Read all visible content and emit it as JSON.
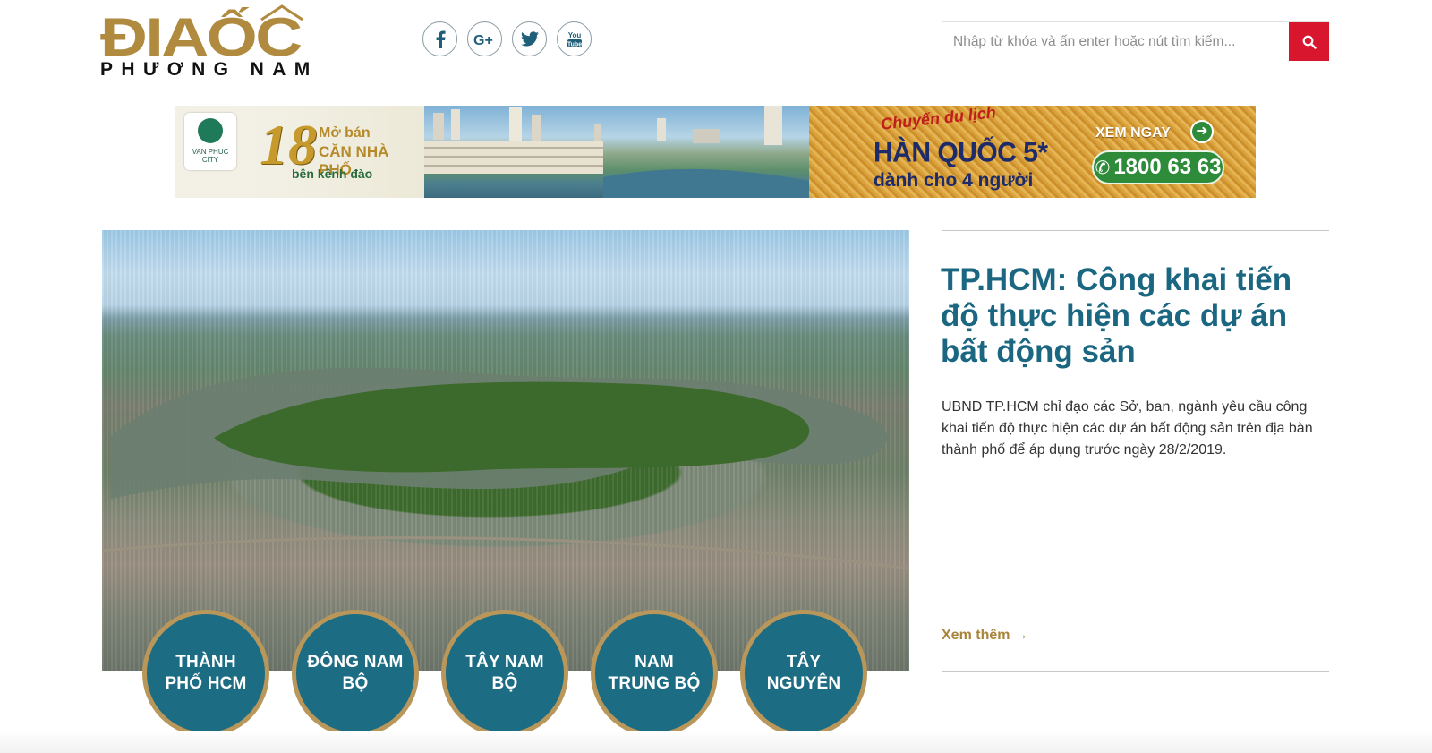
{
  "logo": {
    "top": "ĐIAỐC",
    "bottom": "PHƯƠNG NAM"
  },
  "social": [
    {
      "name": "facebook",
      "icon": "facebook-icon"
    },
    {
      "name": "google-plus",
      "icon": "google-plus-icon"
    },
    {
      "name": "twitter",
      "icon": "twitter-icon"
    },
    {
      "name": "youtube",
      "icon": "youtube-icon"
    }
  ],
  "search": {
    "placeholder": "Nhập từ khóa và ấn enter hoặc nút tìm kiếm...",
    "icon": "search-icon",
    "button_color": "#d8162d"
  },
  "banner": {
    "brand": "VAN PHUC",
    "brand_sub": "CITY",
    "number": "18",
    "line1": "Mở bán",
    "line2": "CĂN NHÀ PHỐ",
    "line3": "bên kênh đào",
    "promo_title": "Chuyến du lịch",
    "promo_main": "HÀN QUỐC 5*",
    "promo_sub": "dành cho 4 người",
    "cta_label": "XEM NGAY",
    "hotline": "1800 63 63"
  },
  "regions": [
    "THÀNH PHỐ HCM",
    "ĐÔNG NAM BỘ",
    "TÂY NAM BỘ",
    "NAM TRUNG BỘ",
    "TÂY NGUYÊN"
  ],
  "article": {
    "headline": "TP.HCM: Công khai tiến độ thực hiện các dự án bất động sản",
    "summary": "UBND TP.HCM chỉ đạo các Sở, ban, ngành yêu cầu công khai tiến độ thực hiện các dự án bất động sản trên địa bàn thành phố để áp dụng trước ngày 28/2/2019.",
    "read_more": "Xem thêm →"
  },
  "colors": {
    "brand_gold": "#b08a3e",
    "accent_teal": "#1b6680",
    "circle_fill": "#1c6c83",
    "circle_border": "#b9965a",
    "search_red": "#d8162d"
  }
}
